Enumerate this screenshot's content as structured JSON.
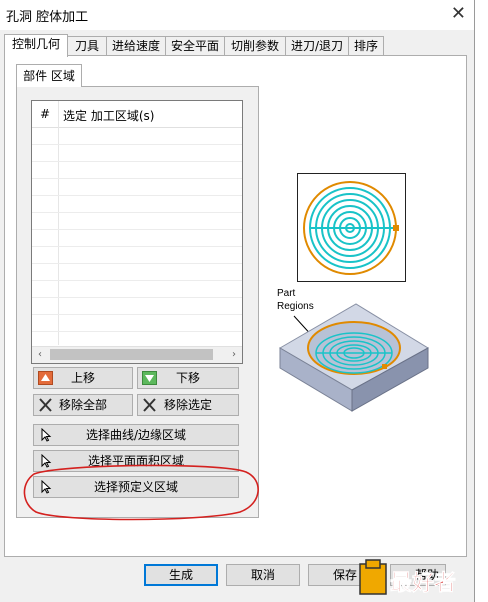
{
  "window": {
    "title": "孔洞 腔体加工",
    "close_glyph": "✕"
  },
  "tabs": [
    "控制几何",
    "刀具",
    "进给速度",
    "安全平面",
    "切削参数",
    "进刀/退刀",
    "排序"
  ],
  "subtab": "部件 区域",
  "list": {
    "col_index": "#",
    "col_name": "选定 加工区域(s)",
    "scroll_left": "‹",
    "scroll_right": "›"
  },
  "buttons": {
    "move_up": "上移",
    "move_down": "下移",
    "remove_all": "移除全部",
    "remove_selected": "移除选定",
    "select_curve": "选择曲线/边缘区域",
    "select_face": "选择平面面积区域",
    "select_predefined": "选择预定义区域"
  },
  "preview": {
    "label_line1": "Part",
    "label_line2": "Regions"
  },
  "dialog": {
    "ok": "生成",
    "cancel": "取消",
    "save": "保存",
    "help": "帮助"
  },
  "watermark": "最好者",
  "colors": {
    "accent": "#0078d7",
    "spiral": "#19c3c8",
    "boundary": "#e08a00",
    "annotation": "#d4211f"
  }
}
